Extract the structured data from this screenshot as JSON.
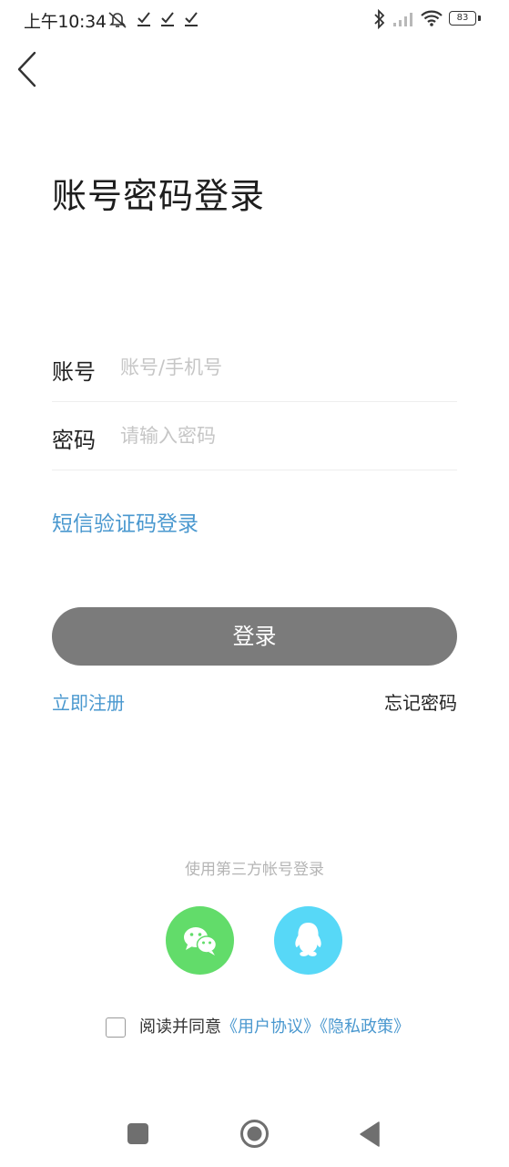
{
  "status_bar": {
    "time": "上午10:34",
    "battery": "83",
    "icons": [
      "mute-alarm-icon",
      "check-icon",
      "check-icon",
      "check-icon",
      "bluetooth-icon",
      "signal-icon",
      "wifi-icon",
      "battery-icon"
    ]
  },
  "header": {
    "back_icon": "chevron-left-icon"
  },
  "title": "账号密码登录",
  "form": {
    "account": {
      "label": "账号",
      "placeholder": "账号/手机号",
      "value": ""
    },
    "password": {
      "label": "密码",
      "placeholder": "请输入密码",
      "value": ""
    }
  },
  "sms_login_label": "短信验证码登录",
  "login_button_label": "登录",
  "register_label": "立即注册",
  "forgot_label": "忘记密码",
  "third_party": {
    "label": "使用第三方帐号登录",
    "providers": [
      {
        "name": "wechat-icon",
        "color": "#62dc6a"
      },
      {
        "name": "qq-icon",
        "color": "#57d8f7"
      }
    ]
  },
  "agreement": {
    "checked": false,
    "text": "阅读并同意",
    "user_agreement": "《用户协议》",
    "privacy_policy": "《隐私政策》"
  },
  "colors": {
    "accent": "#4a98cf",
    "login_button": "#7b7b7b"
  },
  "nav_bar": {
    "icons": [
      "recent-apps-icon",
      "home-icon",
      "back-icon"
    ]
  }
}
